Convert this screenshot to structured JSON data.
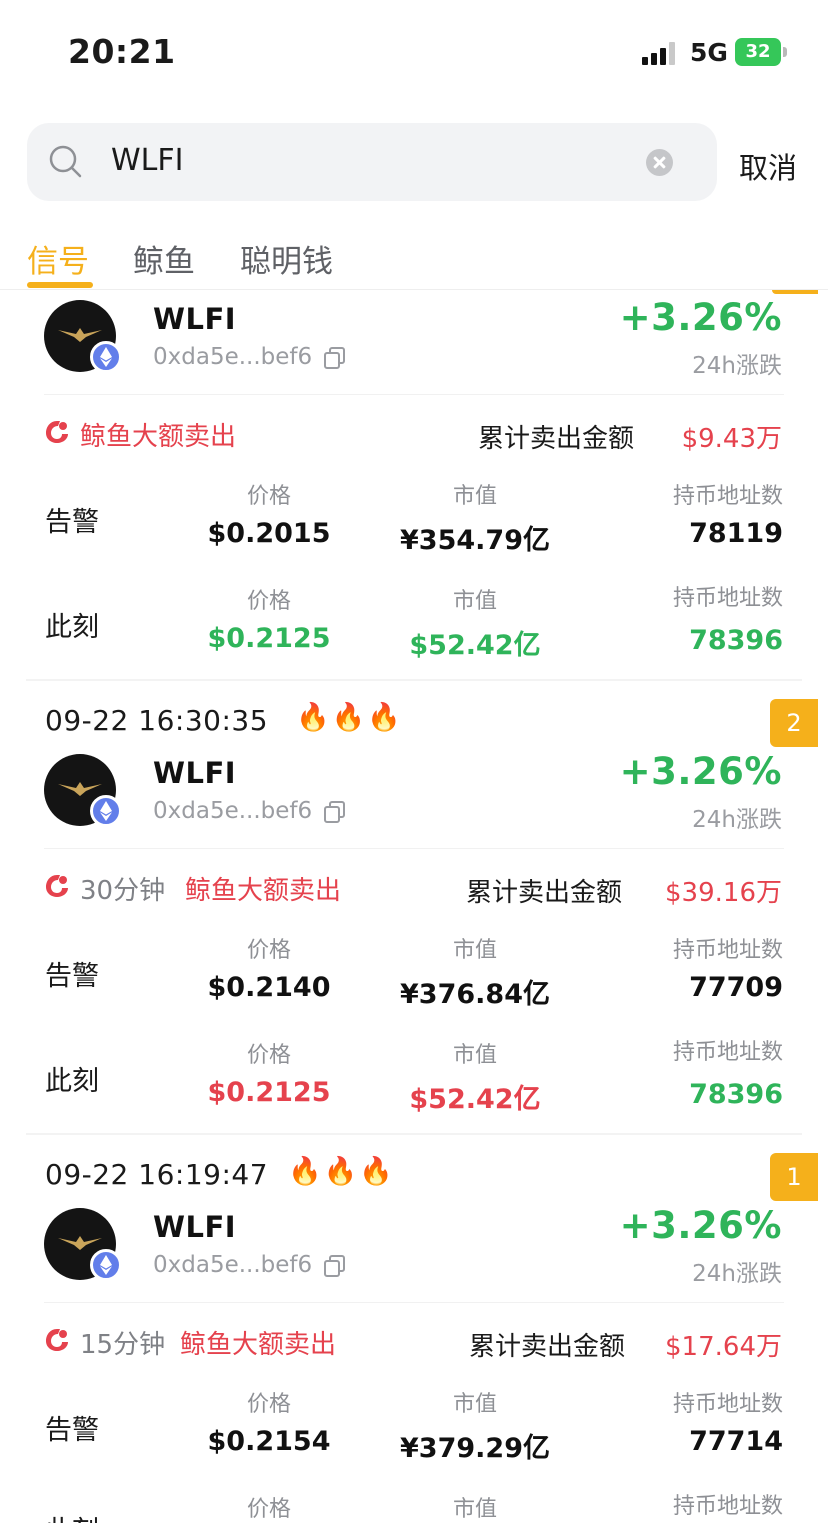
{
  "status_bar": {
    "time": "20:21",
    "network": "5G",
    "battery": "32"
  },
  "search": {
    "query": "WLFI",
    "cancel_label": "取消"
  },
  "tabs": [
    {
      "label": "信号",
      "active": true
    },
    {
      "label": "鲸鱼",
      "active": false
    },
    {
      "label": "聪明钱",
      "active": false
    }
  ],
  "colors": {
    "accent": "#f5b01b",
    "up": "#2fb45a",
    "down": "#e5424d"
  },
  "cards": [
    {
      "token": "WLFI",
      "address": "0xda5e...bef6",
      "change": "+3.26%",
      "change_label": "24h涨跌",
      "alert_duration": "",
      "alert_title": "鲸鱼大额卖出",
      "cum_label": "累计卖出金额",
      "cum_value": "$9.43万",
      "alert_row": {
        "label": "告警",
        "price_head": "价格",
        "price": "$0.2015",
        "mcap_head": "市值",
        "mcap": "¥354.79亿",
        "holders_head": "持币地址数",
        "holders": "78119"
      },
      "now_row": {
        "label": "此刻",
        "price_head": "价格",
        "price": "$0.2125",
        "mcap_head": "市值",
        "mcap": "$52.42亿",
        "holders_head": "持币地址数",
        "holders": "78396"
      }
    },
    {
      "time": "09-22 16:30:35",
      "rank": "2",
      "token": "WLFI",
      "address": "0xda5e...bef6",
      "change": "+3.26%",
      "change_label": "24h涨跌",
      "alert_duration": "30分钟",
      "alert_title": "鲸鱼大额卖出",
      "cum_label": "累计卖出金额",
      "cum_value": "$39.16万",
      "alert_row": {
        "label": "告警",
        "price_head": "价格",
        "price": "$0.2140",
        "mcap_head": "市值",
        "mcap": "¥376.84亿",
        "holders_head": "持币地址数",
        "holders": "77709"
      },
      "now_row": {
        "label": "此刻",
        "price_head": "价格",
        "price": "$0.2125",
        "mcap_head": "市值",
        "mcap": "$52.42亿",
        "holders_head": "持币地址数",
        "holders": "78396"
      }
    },
    {
      "time": "09-22 16:19:47",
      "rank": "1",
      "token": "WLFI",
      "address": "0xda5e...bef6",
      "change": "+3.26%",
      "change_label": "24h涨跌",
      "alert_duration": "15分钟",
      "alert_title": "鲸鱼大额卖出",
      "cum_label": "累计卖出金额",
      "cum_value": "$17.64万",
      "alert_row": {
        "label": "告警",
        "price_head": "价格",
        "price": "$0.2154",
        "mcap_head": "市值",
        "mcap": "¥379.29亿",
        "holders_head": "持币地址数",
        "holders": "77714"
      },
      "now_row": {
        "label": "此刻",
        "price_head": "价格",
        "mcap_head": "市值",
        "holders_head": "持币地址数"
      }
    }
  ]
}
